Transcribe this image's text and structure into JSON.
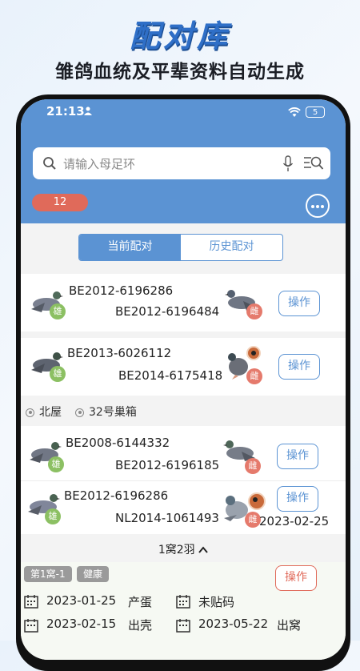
{
  "banner": {
    "title": "配对库",
    "subtitle": "雏鸽血统及平辈资料自动生成"
  },
  "status": {
    "time": "21:13",
    "battery": "5"
  },
  "search": {
    "placeholder": "请输入母足环"
  },
  "count_badge": "12",
  "tabs": [
    {
      "label": "当前配对",
      "active": true
    },
    {
      "label": "历史配对",
      "active": false
    }
  ],
  "pairs": [
    {
      "male_ring": "BE2012-6196286",
      "female_ring": "BE2012-6196484",
      "male_sex": "雄",
      "female_sex": "雌",
      "action": "操作"
    },
    {
      "male_ring": "BE2013-6026112",
      "female_ring": "BE2014-6175418",
      "male_sex": "雄",
      "female_sex": "雌",
      "action": "操作"
    },
    {
      "male_ring": "BE2008-6144332",
      "female_ring": "BE2012-6196185",
      "male_sex": "雄",
      "female_sex": "雌",
      "action": "操作"
    },
    {
      "male_ring": "BE2012-6196286",
      "female_ring": "NL2014-1061493",
      "male_sex": "雄",
      "female_sex": "雌",
      "action": "操作",
      "date": "2023-02-25"
    }
  ],
  "location": {
    "loft": "北屋",
    "box": "32号巢箱"
  },
  "nest_summary": "1窝2羽",
  "nest": {
    "tag": "第1窝-1",
    "health": "健康",
    "action": "操作",
    "records": [
      {
        "date": "2023-01-25",
        "event": "产蛋"
      },
      {
        "date": "",
        "event": "未贴码"
      },
      {
        "date": "2023-02-15",
        "event": "出壳"
      },
      {
        "date": "2023-05-22",
        "event": "出窝"
      }
    ]
  },
  "colors": {
    "primary": "#5b93d3",
    "male": "#8cc063",
    "female": "#e57a6c",
    "danger": "#e06a5a"
  }
}
